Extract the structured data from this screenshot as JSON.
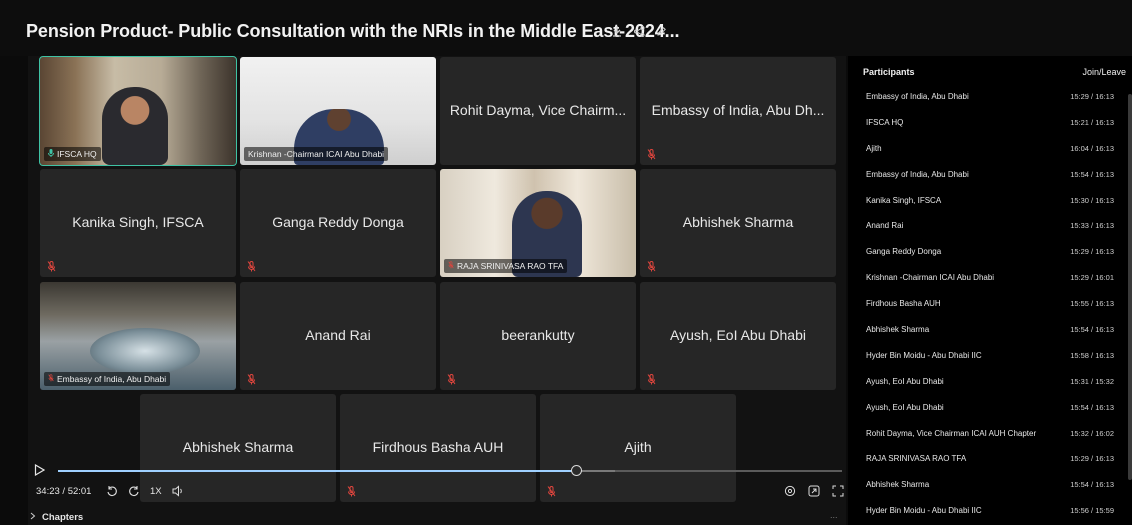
{
  "header": {
    "title": "Pension Product- Public Consultation with the NRIs in the Middle East-2024...",
    "actions": [
      "download-icon",
      "share-icon",
      "edit-icon"
    ]
  },
  "grid": {
    "row1": [
      {
        "label": "IFSCA HQ",
        "video": true,
        "active": true
      },
      {
        "label": "Krishnan -Chairman ICAI Abu Dhabi",
        "video": true
      },
      {
        "name": "Rohit Dayma, Vice Chairm..."
      },
      {
        "name": "Embassy of India, Abu Dh...",
        "muted": true
      }
    ],
    "row2": [
      {
        "name": "Kanika Singh, IFSCA",
        "muted": true
      },
      {
        "name": "Ganga Reddy Donga",
        "muted": true
      },
      {
        "label": "RAJA SRINIVASA RAO TFA",
        "video": true,
        "muted": true
      },
      {
        "name": "Abhishek Sharma",
        "muted": true
      }
    ],
    "row3": [
      {
        "label": "Embassy of India, Abu Dhabi",
        "video": true,
        "muted": true
      },
      {
        "name": "Anand Rai",
        "muted": true
      },
      {
        "name": "beerankutty",
        "muted": true
      },
      {
        "name": "Ayush, EoI Abu Dhabi",
        "muted": true
      }
    ],
    "row4": [
      {
        "name": "Abhishek Sharma"
      },
      {
        "name": "Firdhous Basha AUH",
        "muted": true
      },
      {
        "name": "Ajith",
        "muted": true
      }
    ]
  },
  "player": {
    "time": "34:23 / 52:01",
    "speed": "1X",
    "progress": 0.661,
    "buffered": 0.71
  },
  "chapters": {
    "label": "Chapters"
  },
  "more": "...",
  "participants": {
    "title": "Participants",
    "col": "Join/Leave",
    "rows": [
      {
        "name": "Embassy of India, Abu Dhabi",
        "time": "15:29 / 16:13"
      },
      {
        "name": "IFSCA HQ",
        "time": "15:21 / 16:13"
      },
      {
        "name": "Ajith",
        "time": "16:04 / 16:13"
      },
      {
        "name": "Embassy of India, Abu Dhabi",
        "time": "15:54 / 16:13"
      },
      {
        "name": "Kanika Singh, IFSCA",
        "time": "15:30 / 16:13"
      },
      {
        "name": "Anand Rai",
        "time": "15:33 / 16:13"
      },
      {
        "name": "Ganga Reddy Donga",
        "time": "15:29 / 16:13"
      },
      {
        "name": "Krishnan -Chairman ICAI Abu Dhabi",
        "time": "15:29 / 16:01"
      },
      {
        "name": "Firdhous Basha AUH",
        "time": "15:55 / 16:13"
      },
      {
        "name": "Abhishek Sharma",
        "time": "15:54 / 16:13"
      },
      {
        "name": "Hyder Bin Moidu - Abu Dhabi IIC",
        "time": "15:58 / 16:13"
      },
      {
        "name": "Ayush, EoI Abu Dhabi",
        "time": "15:31 / 15:32"
      },
      {
        "name": "Ayush, EoI Abu Dhabi",
        "time": "15:54 / 16:13"
      },
      {
        "name": "Rohit Dayma, Vice Chairman ICAI AUH Chapter",
        "time": "15:32 / 16:02"
      },
      {
        "name": "RAJA SRINIVASA RAO TFA",
        "time": "15:29 / 16:13"
      },
      {
        "name": "Abhishek Sharma",
        "time": "15:54 / 16:13"
      },
      {
        "name": "Hyder Bin Moidu - Abu Dhabi IIC",
        "time": "15:56 / 15:59"
      }
    ]
  },
  "colors": {
    "accent": "#3fc3a5",
    "muted_mic": "#e0453d",
    "progress": "#9fd0ff"
  }
}
